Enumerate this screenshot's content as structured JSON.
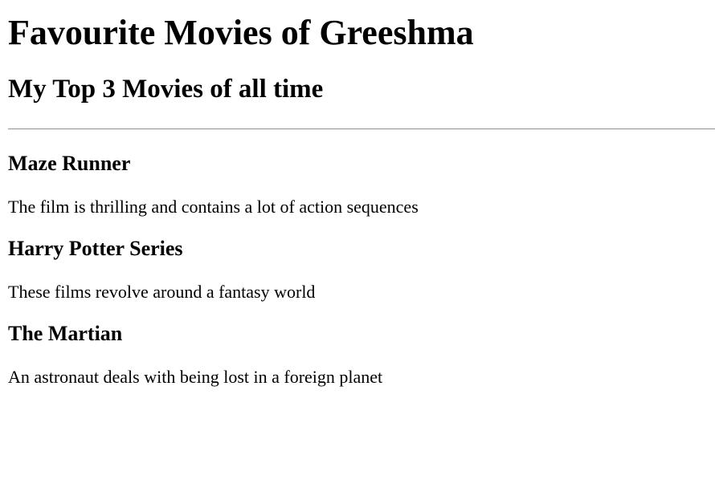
{
  "page": {
    "title": "Favourite Movies of Greeshma",
    "subtitle": "My Top 3 Movies of all time"
  },
  "movies": [
    {
      "title": "Maze Runner",
      "description": "The film is thrilling and contains a lot of action sequences"
    },
    {
      "title": "Harry Potter Series",
      "description": "These films revolve around a fantasy world"
    },
    {
      "title": "The Martian",
      "description": "An astronaut deals with being lost in a foreign planet"
    }
  ]
}
